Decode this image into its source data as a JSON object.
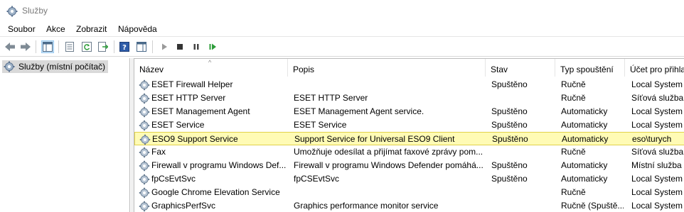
{
  "window": {
    "title": "Služby"
  },
  "menu": [
    "Soubor",
    "Akce",
    "Zobrazit",
    "Nápověda"
  ],
  "tree": {
    "root_label": "Služby (místní počítač)"
  },
  "columns": [
    "Název",
    "Popis",
    "Stav",
    "Typ spouštění",
    "Účet pro přihla"
  ],
  "rows": [
    {
      "name": "ESET Firewall Helper",
      "desc": "",
      "status": "Spuštěno",
      "startup": "Ručně",
      "account": "Local System",
      "selected": false
    },
    {
      "name": "ESET HTTP Server",
      "desc": "ESET HTTP Server",
      "status": "",
      "startup": "Ručně",
      "account": "Síťová služba",
      "selected": false
    },
    {
      "name": "ESET Management Agent",
      "desc": "ESET Management Agent service.",
      "status": "Spuštěno",
      "startup": "Automaticky",
      "account": "Local System",
      "selected": false
    },
    {
      "name": "ESET Service",
      "desc": "ESET Service",
      "status": "Spuštěno",
      "startup": "Automaticky",
      "account": "Local System",
      "selected": false
    },
    {
      "name": "ESO9 Support Service",
      "desc": "Support Service for Universal ESO9 Client",
      "status": "Spuštěno",
      "startup": "Automaticky",
      "account": "eso\\turych",
      "selected": true
    },
    {
      "name": "Fax",
      "desc": "Umožňuje odesílat a přijímat faxové zprávy pom...",
      "status": "",
      "startup": "Ručně",
      "account": "Síťová služba",
      "selected": false
    },
    {
      "name": "Firewall v programu Windows Def...",
      "desc": "Firewall v programu Windows Defender pomáhá...",
      "status": "Spuštěno",
      "startup": "Automaticky",
      "account": "Místní služba",
      "selected": false
    },
    {
      "name": "fpCsEvtSvc",
      "desc": "fpCSEvtSvc",
      "status": "Spuštěno",
      "startup": "Automaticky",
      "account": "Local System",
      "selected": false
    },
    {
      "name": "Google Chrome Elevation Service",
      "desc": "",
      "status": "",
      "startup": "Ručně",
      "account": "Local System",
      "selected": false
    },
    {
      "name": "GraphicsPerfSvc",
      "desc": "Graphics performance monitor service",
      "status": "",
      "startup": "Ručně (Spuště...",
      "account": "Local System",
      "selected": false
    }
  ],
  "colors": {
    "selection_bg": "#fffbb5",
    "selection_border": "#e1d14a",
    "tree_selected": "#d9d9d9"
  }
}
